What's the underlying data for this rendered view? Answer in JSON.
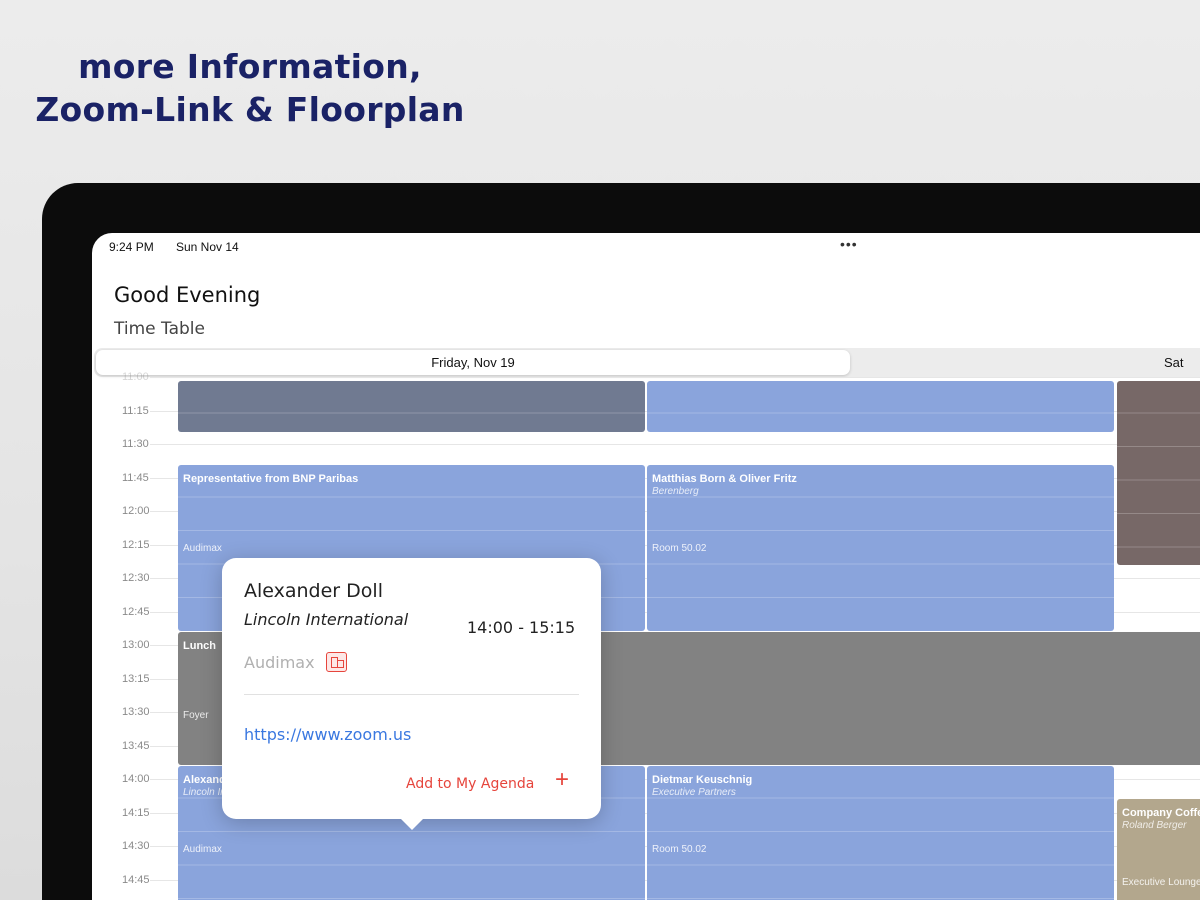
{
  "marketing": {
    "headline_line1": "more Information,",
    "headline_line2": "Zoom-Link & Floorplan"
  },
  "status_bar": {
    "time": "9:24 PM",
    "date": "Sun Nov 14",
    "multitask_indicator": "•••"
  },
  "header": {
    "greeting": "Good Evening",
    "subtitle": "Time Table"
  },
  "day_tabs": [
    {
      "label": "Friday, Nov 19",
      "selected": true
    },
    {
      "label": "Sat",
      "selected": false
    }
  ],
  "time_labels": [
    "11:00",
    "11:15",
    "11:30",
    "11:45",
    "12:00",
    "12:15",
    "12:30",
    "12:45",
    "13:00",
    "13:15",
    "13:30",
    "13:45",
    "14:00",
    "14:15",
    "14:30",
    "14:45"
  ],
  "events": {
    "top_slate": {
      "title": "",
      "color": "#707a91"
    },
    "top_blue": {
      "title": "",
      "color": "#8aa4dc"
    },
    "right_brown": {
      "title": "",
      "color": "#776867"
    },
    "bnp": {
      "title": "Representative from BNP Paribas",
      "room": "Audimax",
      "color": "#8aa4dc"
    },
    "berenberg": {
      "title": "Matthias Born & Oliver Fritz",
      "subtitle": "Berenberg",
      "room": "Room 50.02",
      "color": "#8aa4dc"
    },
    "lunch": {
      "title": "Lunch",
      "room": "Foyer",
      "color": "#828282"
    },
    "alexander": {
      "title": "Alexander Doll",
      "subtitle": "Lincoln International",
      "room": "Audimax",
      "color": "#8aa4dc"
    },
    "dietmar": {
      "title": "Dietmar Keuschnig",
      "subtitle": "Executive Partners",
      "room": "Room 50.02",
      "color": "#8aa4dc"
    },
    "company": {
      "title": "Company Coffee",
      "subtitle": "Roland Berger",
      "room": "Executive Lounge",
      "color": "#b3a78d"
    }
  },
  "popover": {
    "name": "Alexander Doll",
    "company": "Lincoln International",
    "time": "14:00 - 15:15",
    "room": "Audimax",
    "floorplan_icon": "floorplan-icon",
    "link": "https://www.zoom.us",
    "add_label": "Add to My Agenda",
    "add_icon": "+",
    "accent": "#e6453c",
    "link_color": "#3a78e0"
  }
}
